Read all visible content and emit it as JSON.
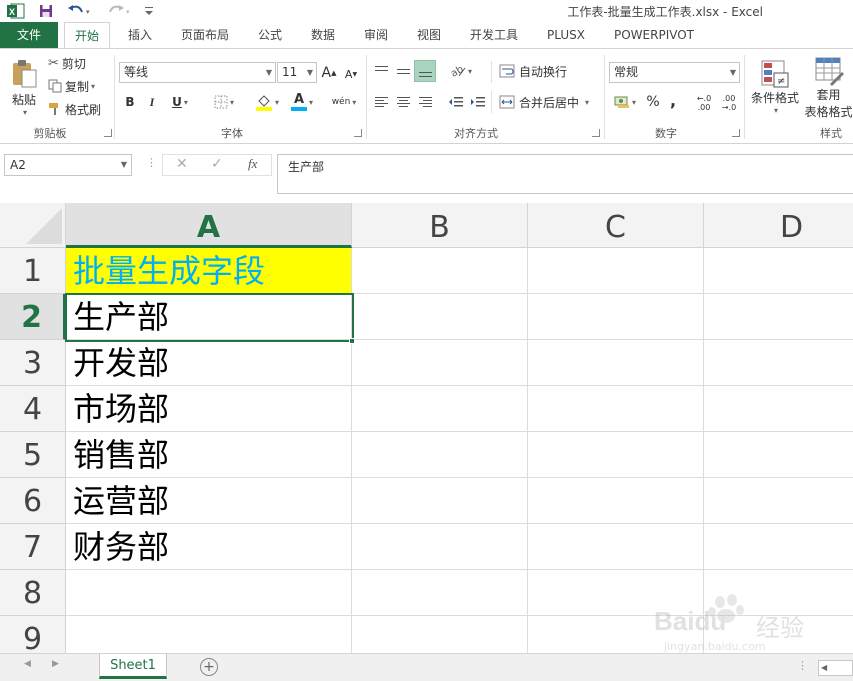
{
  "window": {
    "title": "工作表-批量生成工作表.xlsx - Excel"
  },
  "ribbon_tabs": [
    "文件",
    "开始",
    "插入",
    "页面布局",
    "公式",
    "数据",
    "审阅",
    "视图",
    "开发工具",
    "PLUSX",
    "POWERPIVOT"
  ],
  "clipboard": {
    "paste": "粘贴",
    "cut": "剪切",
    "copy": "复制",
    "format_painter": "格式刷",
    "group_label": "剪贴板"
  },
  "font": {
    "name": "等线",
    "size": "11",
    "group_label": "字体",
    "grow": "A",
    "shrink": "A",
    "bold": "B",
    "italic": "I",
    "underline": "U",
    "phonetic": "wén",
    "font_color_letter": "A"
  },
  "alignment": {
    "wrap_text": "自动换行",
    "merge_center": "合并后居中",
    "group_label": "对齐方式"
  },
  "number": {
    "format": "常规",
    "percent": "%",
    "comma": ",",
    "group_label": "数字",
    "inc_decimal": "←.0 .00",
    "dec_decimal": ".00 →.0"
  },
  "styles": {
    "conditional_format": "条件格式",
    "table_format_1": "套用",
    "table_format_2": "表格格式",
    "group_label": "样式"
  },
  "formula_bar": {
    "name_box": "A2",
    "cancel": "✕",
    "enter": "✓",
    "fx": "fx",
    "content": "生产部"
  },
  "columns": [
    "A",
    "B",
    "C",
    "D"
  ],
  "rows": [
    "1",
    "2",
    "3",
    "4",
    "5",
    "6",
    "7",
    "8",
    "9"
  ],
  "cells_a": [
    "批量生成字段",
    "生产部",
    "开发部",
    "市场部",
    "销售部",
    "运营部",
    "财务部",
    "",
    ""
  ],
  "sheet_tabs": [
    "Sheet1"
  ],
  "colors": {
    "excel_green": "#217346",
    "highlight_fill": "#ffff00",
    "highlight_text": "#00b0f0"
  },
  "watermark": {
    "brand": "Baidu",
    "cn": "经验",
    "url": "jingyan.baidu.com"
  }
}
